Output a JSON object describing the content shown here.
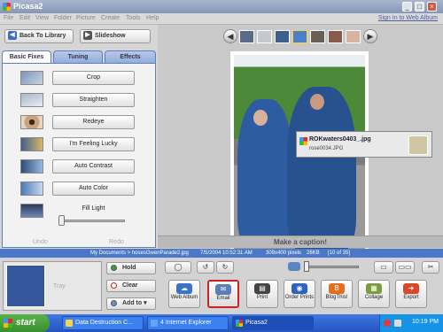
{
  "window": {
    "title": "Picasa2",
    "min": "_",
    "max": "□",
    "close": "×"
  },
  "menu": {
    "items": [
      "File",
      "Edit",
      "View",
      "Folder",
      "Picture",
      "Create",
      "Tools",
      "Help"
    ],
    "signin": "Sign In to Web Album"
  },
  "nav": {
    "back_label": "Back To Library",
    "slideshow_label": "Slideshow"
  },
  "tabs": [
    {
      "label": "Basic Fixes"
    },
    {
      "label": "Tuning"
    },
    {
      "label": "Effects"
    }
  ],
  "fixes": [
    {
      "label": "Crop"
    },
    {
      "label": "Straighten"
    },
    {
      "label": "Redeye"
    },
    {
      "label": "I'm Feeling Lucky"
    },
    {
      "label": "Auto Contrast"
    },
    {
      "label": "Auto Color"
    }
  ],
  "fill_light": {
    "label": "Fill Light",
    "value": 0
  },
  "undo_row": {
    "undo": "Undo",
    "redo": "Redo"
  },
  "tooltip": {
    "title": "ROKwaters0403_.jpg",
    "subtitle": "rose0034.JPG"
  },
  "caption": {
    "placeholder": "Make a caption!"
  },
  "status": {
    "path": "My Documents > hosesGwenParade2.jpg",
    "date": "7/5/2004 10:52:31 AM",
    "dims": "309x400 pixels",
    "size": "26KB",
    "index": "[10 of 35]"
  },
  "tray": {
    "label": "Tray",
    "hold": "Hold",
    "clear": "Clear",
    "add_to": "Add to"
  },
  "actions": [
    {
      "label": "Web Album",
      "color": "#3a73c8"
    },
    {
      "label": "Email",
      "color": "#5a7fb8"
    },
    {
      "label": "Print",
      "color": "#444444"
    },
    {
      "label": "Order Prints",
      "color": "#2f63c1"
    },
    {
      "label": "BlogThis!",
      "color": "#e66d1b"
    },
    {
      "label": "Collage",
      "color": "#7a9c3a"
    },
    {
      "label": "Export",
      "color": "#d9482a"
    }
  ],
  "taskbar": {
    "start": "start",
    "tasks": [
      "Data Destruction C...",
      "4 Internet Explorer",
      "Picasa2"
    ],
    "clock": "10:19 PM"
  }
}
